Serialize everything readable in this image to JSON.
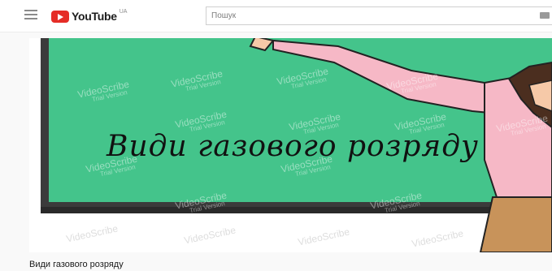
{
  "header": {
    "logo_text": "YouTube",
    "country_code": "UA",
    "search_placeholder": "Пошук",
    "brand_color": "#e52d27"
  },
  "player": {
    "board_text": "Види газового розряду",
    "watermark_main": "VideoScribe",
    "watermark_sub": "Trial Version",
    "board_color": "#44c48b",
    "frame_color": "#3b3b3b"
  },
  "video": {
    "title": "Види газового розряду"
  },
  "icons": [
    "menu-icon",
    "youtube-logo-icon",
    "keyboard-icon"
  ]
}
